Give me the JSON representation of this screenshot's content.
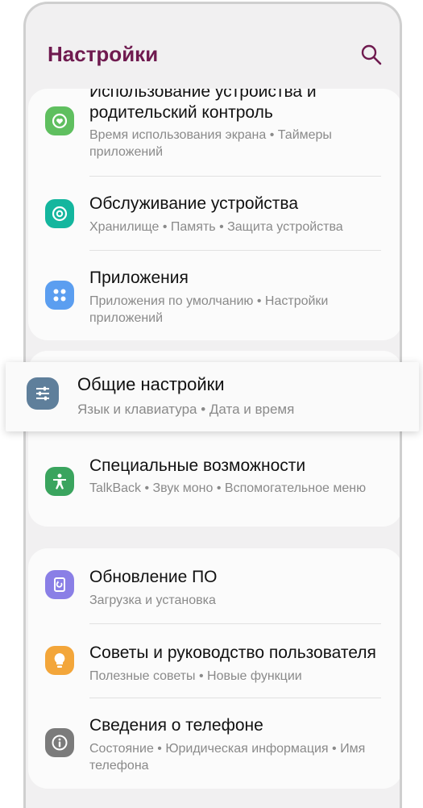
{
  "header": {
    "title": "Настройки"
  },
  "icons": {
    "search": "search-icon"
  },
  "colors": {
    "title": "#6f1a4f",
    "background": "#f1f0f1",
    "card": "#fbfbfb"
  },
  "items": [
    {
      "label": "Использование устройства и родительский контроль",
      "label_line1": "Использование устройства и",
      "label_line2": "родительский контроль",
      "sub": "Время использования экрана • Таймеры приложений",
      "icon": "wellbeing-icon",
      "color": "#5fbf5f"
    },
    {
      "label": "Обслуживание устройства",
      "sub": "Хранилище • Память • Защита устройства",
      "icon": "device-care-icon",
      "color": "#14b69e"
    },
    {
      "label": "Приложения",
      "sub": "Приложения по умолчанию • Настройки приложений",
      "icon": "apps-icon",
      "color": "#5b9ef0"
    },
    {
      "label": "Общие настройки",
      "sub": "Язык и клавиатура • Дата и время",
      "icon": "sliders-icon",
      "color": "#5f7f9b"
    },
    {
      "label": "Специальные возможности",
      "sub": "TalkBack • Звук моно • Вспомогательное меню",
      "icon": "accessibility-icon",
      "color": "#3aa45e"
    },
    {
      "label": "Обновление ПО",
      "sub": "Загрузка и установка",
      "icon": "software-update-icon",
      "color": "#8a7fe6"
    },
    {
      "label": "Советы и руководство пользователя",
      "sub": "Полезные советы • Новые функции",
      "icon": "tips-icon",
      "color": "#f3a63a"
    },
    {
      "label": "Сведения о телефоне",
      "sub": "Состояние • Юридическая информация • Имя телефона",
      "icon": "info-icon",
      "color": "#7b7b7b"
    }
  ]
}
